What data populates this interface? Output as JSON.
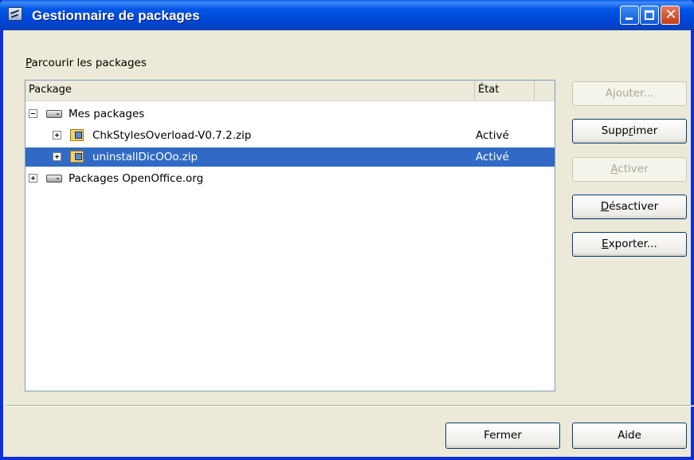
{
  "window": {
    "title": "Gestionnaire de packages"
  },
  "group_label": {
    "mnemonic": "P",
    "rest": "arcourir les packages"
  },
  "columns": {
    "package": "Package",
    "state": "État"
  },
  "tree": [
    {
      "label": "Mes packages",
      "state": "",
      "level": 0,
      "expander": "minus",
      "icon": "drive-icon",
      "selected": false
    },
    {
      "label": "ChkStylesOverload-V0.7.2.zip",
      "state": "Activé",
      "level": 1,
      "expander": "plus",
      "icon": "zip-package-icon",
      "selected": false
    },
    {
      "label": "uninstallDicOOo.zip",
      "state": "Activé",
      "level": 1,
      "expander": "plus",
      "icon": "zip-package-icon",
      "selected": true
    },
    {
      "label": "Packages OpenOffice.org",
      "state": "",
      "level": 0,
      "expander": "plus",
      "icon": "drive-icon",
      "selected": false
    }
  ],
  "buttons": {
    "ajouter": {
      "pre": "A",
      "u": "j",
      "post": "outer...",
      "enabled": false
    },
    "supprimer": {
      "pre": "Supp",
      "u": "r",
      "post": "imer",
      "enabled": true
    },
    "activer": {
      "pre": "",
      "u": "A",
      "post": "ctiver",
      "enabled": false
    },
    "desactiver": {
      "pre": "",
      "u": "D",
      "post": "ésactiver",
      "enabled": true
    },
    "exporter": {
      "pre": "",
      "u": "E",
      "post": "xporter...",
      "enabled": true
    },
    "fermer": {
      "label": "Fermer"
    },
    "aide": {
      "label": "Aide"
    }
  },
  "colors": {
    "selection": "#316ac5",
    "titlebar": "#0055e5",
    "dialog": "#ece9d8"
  }
}
